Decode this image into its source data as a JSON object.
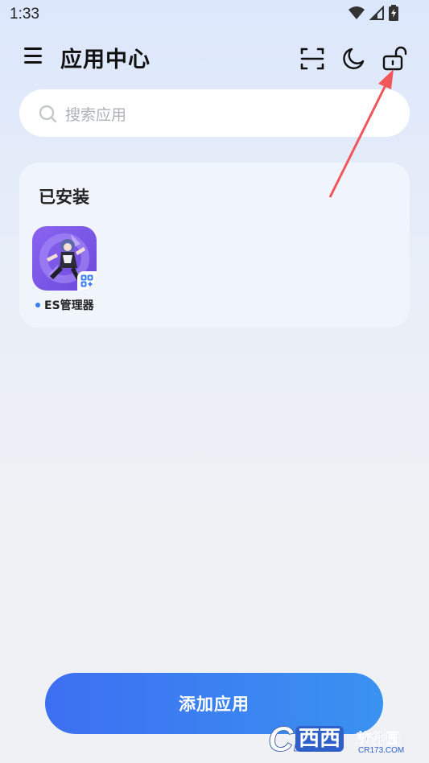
{
  "status_bar": {
    "time": "1:33",
    "icons": [
      "wifi-icon",
      "signal-icon",
      "battery-charging-icon"
    ]
  },
  "header": {
    "title": "应用中心",
    "icons": [
      "menu-icon",
      "scan-icon",
      "moon-icon",
      "unlock-icon"
    ]
  },
  "search": {
    "placeholder": "搜索应用"
  },
  "installed": {
    "section_title": "已安装",
    "apps": [
      {
        "label": "ES管理器",
        "icon": "anime-character-app-icon",
        "badge": "clone-badge-icon"
      }
    ]
  },
  "footer": {
    "add_button_label": "添加应用"
  },
  "watermark": {
    "brand": "西西",
    "text": "软件园",
    "url": "CR173.COM"
  },
  "colors": {
    "accent": "#3b82f0",
    "arrow": "#f0565a",
    "app_icon_bg": "#7b5ae8"
  }
}
